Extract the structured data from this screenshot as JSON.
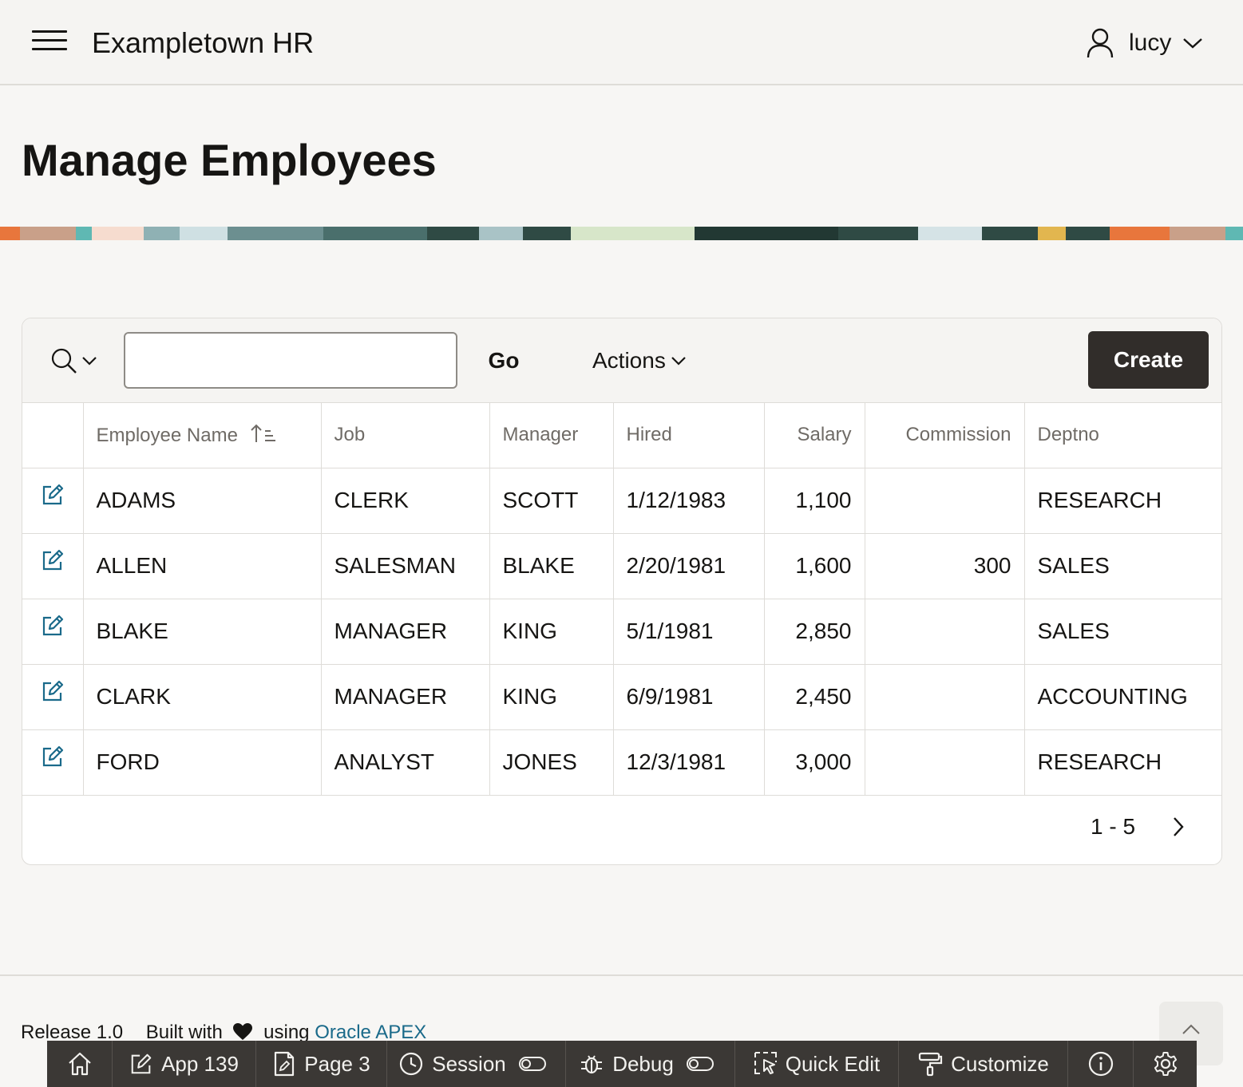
{
  "app": {
    "title": "Exampletown HR"
  },
  "user": {
    "name": "lucy"
  },
  "page": {
    "title": "Manage Employees"
  },
  "toolbar": {
    "search_value": "",
    "go_label": "Go",
    "actions_label": "Actions",
    "create_label": "Create"
  },
  "report": {
    "columns": [
      "Employee Name",
      "Job",
      "Manager",
      "Hired",
      "Salary",
      "Commission",
      "Deptno"
    ],
    "sorted_column": "Employee Name",
    "sort_direction": "ascending",
    "rows": [
      {
        "ename": "ADAMS",
        "job": "CLERK",
        "mgr": "SCOTT",
        "hired": "1/12/1983",
        "sal": "1,100",
        "comm": "",
        "dept": "RESEARCH"
      },
      {
        "ename": "ALLEN",
        "job": "SALESMAN",
        "mgr": "BLAKE",
        "hired": "2/20/1981",
        "sal": "1,600",
        "comm": "300",
        "dept": "SALES"
      },
      {
        "ename": "BLAKE",
        "job": "MANAGER",
        "mgr": "KING",
        "hired": "5/1/1981",
        "sal": "2,850",
        "comm": "",
        "dept": "SALES"
      },
      {
        "ename": "CLARK",
        "job": "MANAGER",
        "mgr": "KING",
        "hired": "6/9/1981",
        "sal": "2,450",
        "comm": "",
        "dept": "ACCOUNTING"
      },
      {
        "ename": "FORD",
        "job": "ANALYST",
        "mgr": "JONES",
        "hired": "12/3/1981",
        "sal": "3,000",
        "comm": "",
        "dept": "RESEARCH"
      }
    ],
    "pagination": "1 - 5"
  },
  "footer": {
    "release": "Release 1.0",
    "built_with": "Built with",
    "using": "using",
    "link": "Oracle APEX"
  },
  "devbar": {
    "app": "App 139",
    "page": "Page 3",
    "session": "Session",
    "debug": "Debug",
    "quick_edit": "Quick Edit",
    "customize": "Customize"
  },
  "colors": {
    "edit_icon": "#1a6a8a",
    "create_button": "#312d2a",
    "link": "#1a6a8a",
    "dev_toolbar": "#3b3835"
  }
}
